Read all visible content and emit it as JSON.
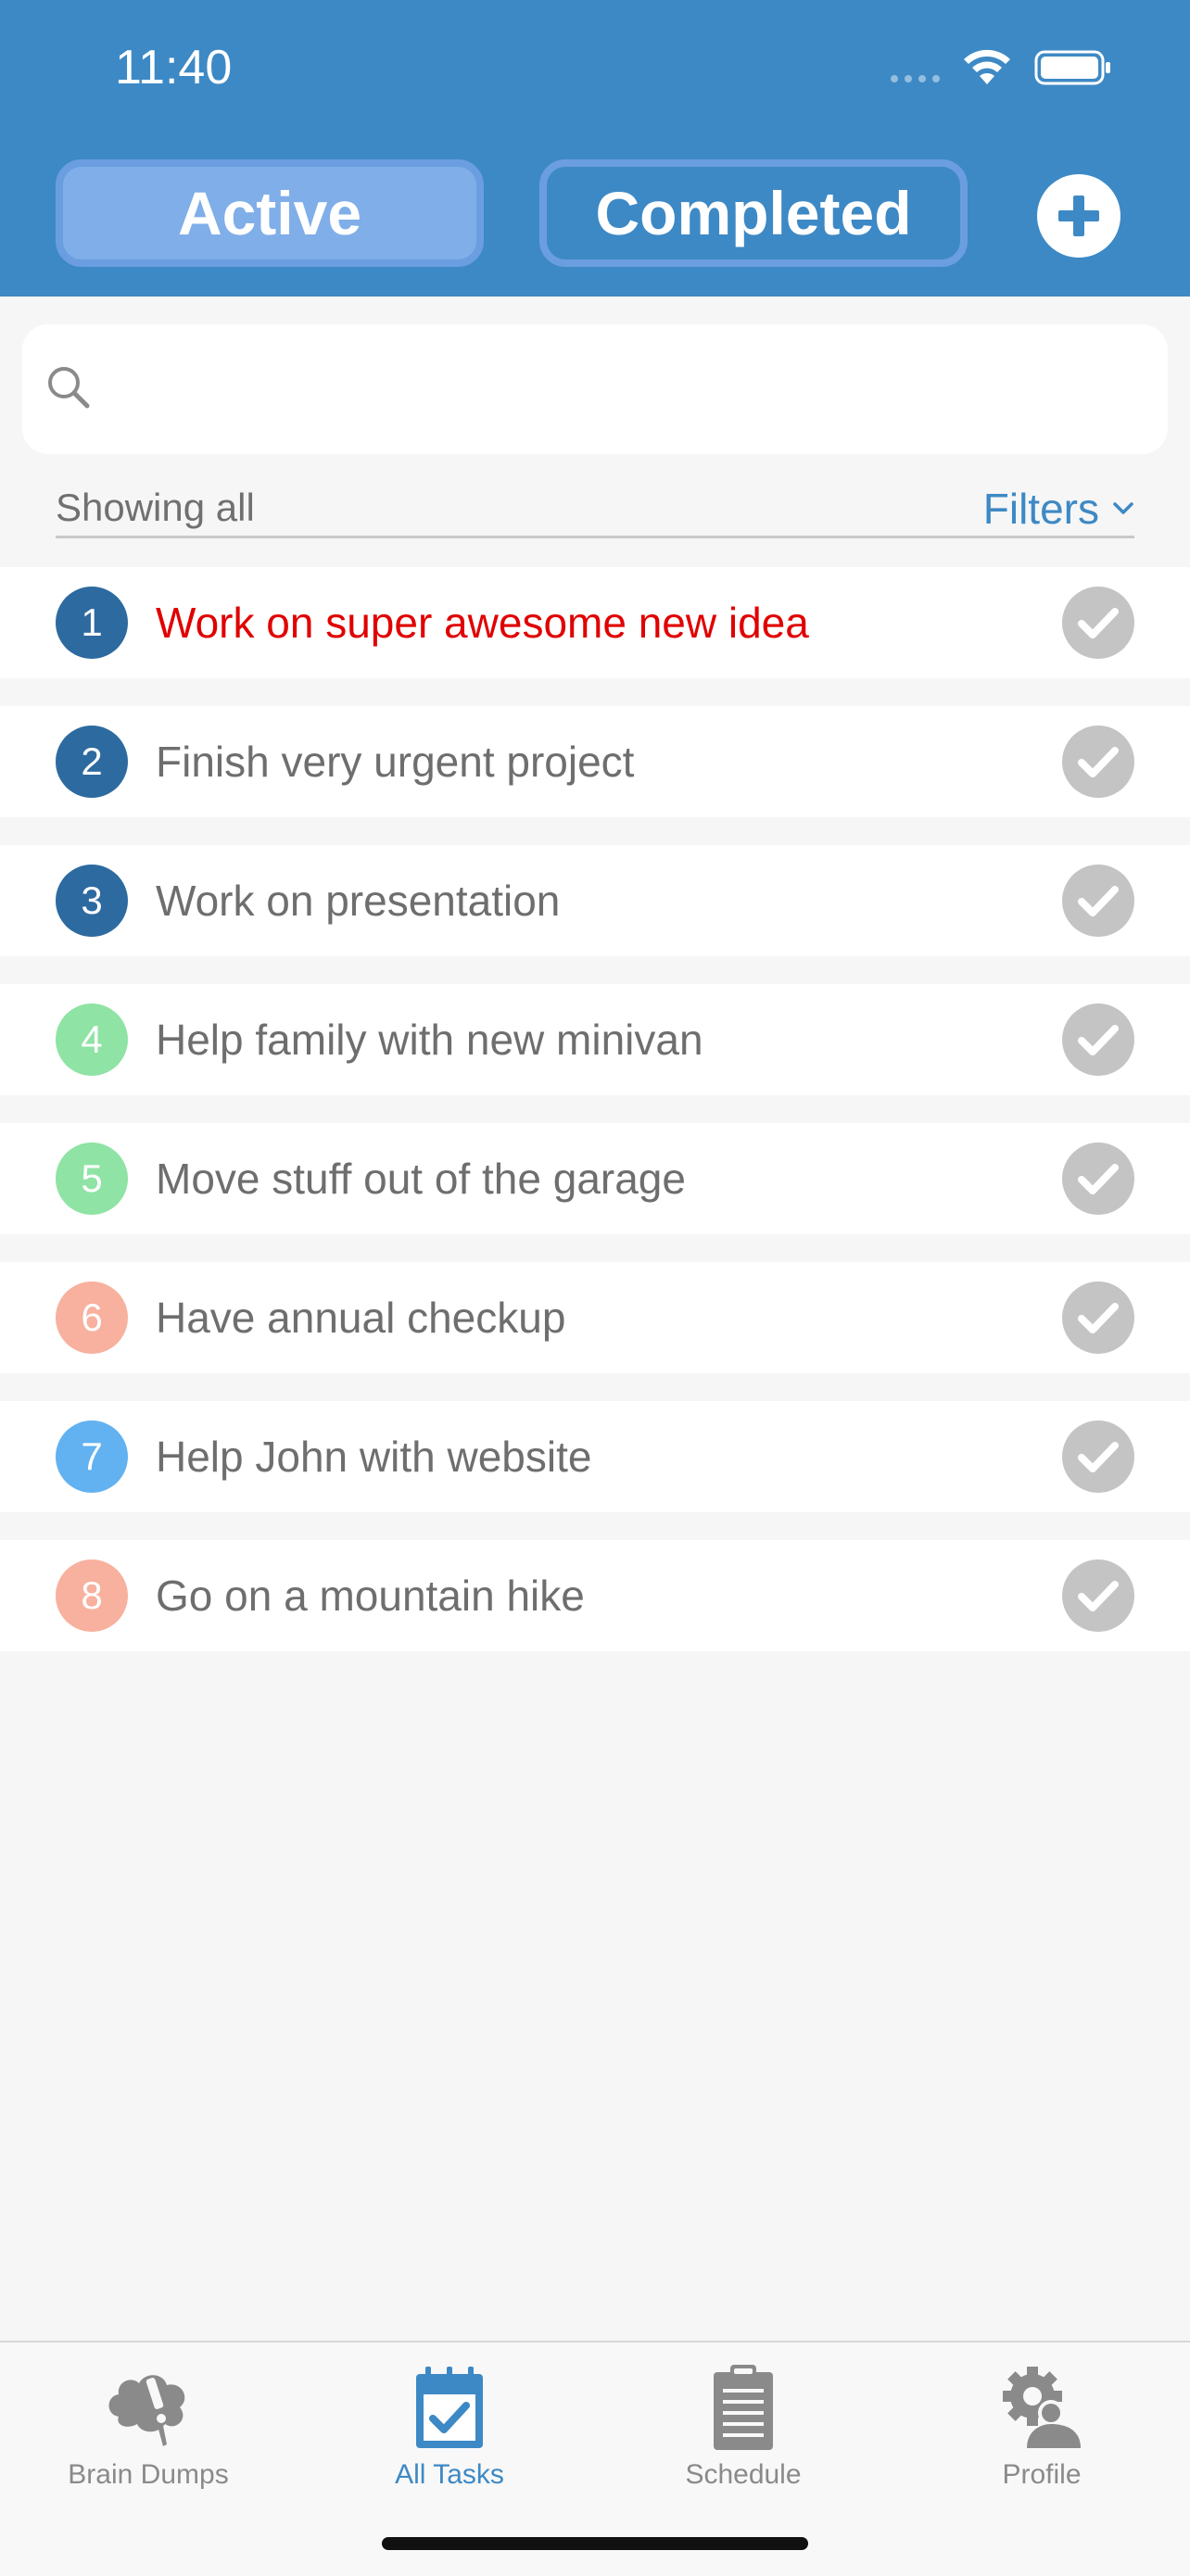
{
  "status": {
    "time": "11:40"
  },
  "header": {
    "segments": [
      {
        "label": "Active",
        "selected": true
      },
      {
        "label": "Completed",
        "selected": false
      }
    ],
    "add_icon": "plus-circle-icon"
  },
  "search": {
    "placeholder": "",
    "icon": "search-icon"
  },
  "filter_bar": {
    "showing_label": "Showing all",
    "filters_label": "Filters"
  },
  "tasks": [
    {
      "number": "1",
      "title": "Work on super awesome new idea",
      "color": "#2d6aa0",
      "urgent": true
    },
    {
      "number": "2",
      "title": "Finish very urgent project",
      "color": "#2d6aa0",
      "urgent": false
    },
    {
      "number": "3",
      "title": "Work on presentation",
      "color": "#2d6aa0",
      "urgent": false
    },
    {
      "number": "4",
      "title": "Help family with new minivan",
      "color": "#8fe3a4",
      "urgent": false
    },
    {
      "number": "5",
      "title": "Move stuff out of the garage",
      "color": "#8fe3a4",
      "urgent": false
    },
    {
      "number": "6",
      "title": "Have annual checkup",
      "color": "#f7b19e",
      "urgent": false
    },
    {
      "number": "7",
      "title": "Help John with website",
      "color": "#62b1f1",
      "urgent": false
    },
    {
      "number": "8",
      "title": "Go on a mountain hike",
      "color": "#f7b19e",
      "urgent": false
    }
  ],
  "tabbar": {
    "tabs": [
      {
        "label": "Brain Dumps",
        "icon": "brain-dump-icon",
        "selected": false
      },
      {
        "label": "All Tasks",
        "icon": "calendar-check-icon",
        "selected": true
      },
      {
        "label": "Schedule",
        "icon": "clipboard-icon",
        "selected": false
      },
      {
        "label": "Profile",
        "icon": "profile-gear-icon",
        "selected": false
      }
    ]
  },
  "colors": {
    "header_bg": "#3d89c5",
    "accent": "#3d89c5",
    "urgent_text": "#e00000",
    "check_circle": "#c4c4c4"
  }
}
